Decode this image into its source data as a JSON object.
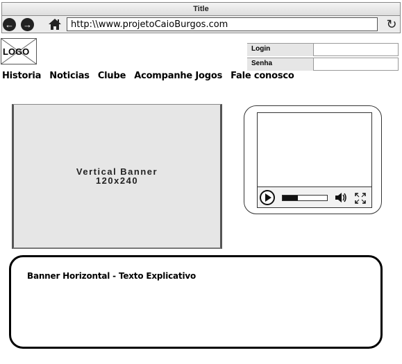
{
  "window": {
    "title": "Title"
  },
  "toolbar": {
    "back_icon": "arrow-left-icon",
    "forward_icon": "arrow-right-icon",
    "home_icon": "home-icon",
    "url": "http:\\\\www.projetoCaioBurgos.com",
    "refresh_icon": "refresh-icon"
  },
  "page": {
    "logo_label": "LOGO",
    "login": {
      "login_label": "Login",
      "senha_label": "Senha"
    },
    "menu": [
      "Historia",
      "Noticias",
      "Clube",
      "Acompanhe Jogos",
      "Fale conosco"
    ],
    "vertical_banner": {
      "line1": "Vertical Banner",
      "line2": "120x240"
    },
    "video_player": {
      "progress": 0.35
    },
    "horizontal_banner": {
      "text": "Banner Horizontal - Texto Explicativo"
    }
  },
  "colors": {
    "accent": "#000000",
    "panel_grey": "#e6e6e6",
    "chrome_grey": "#ececec"
  }
}
